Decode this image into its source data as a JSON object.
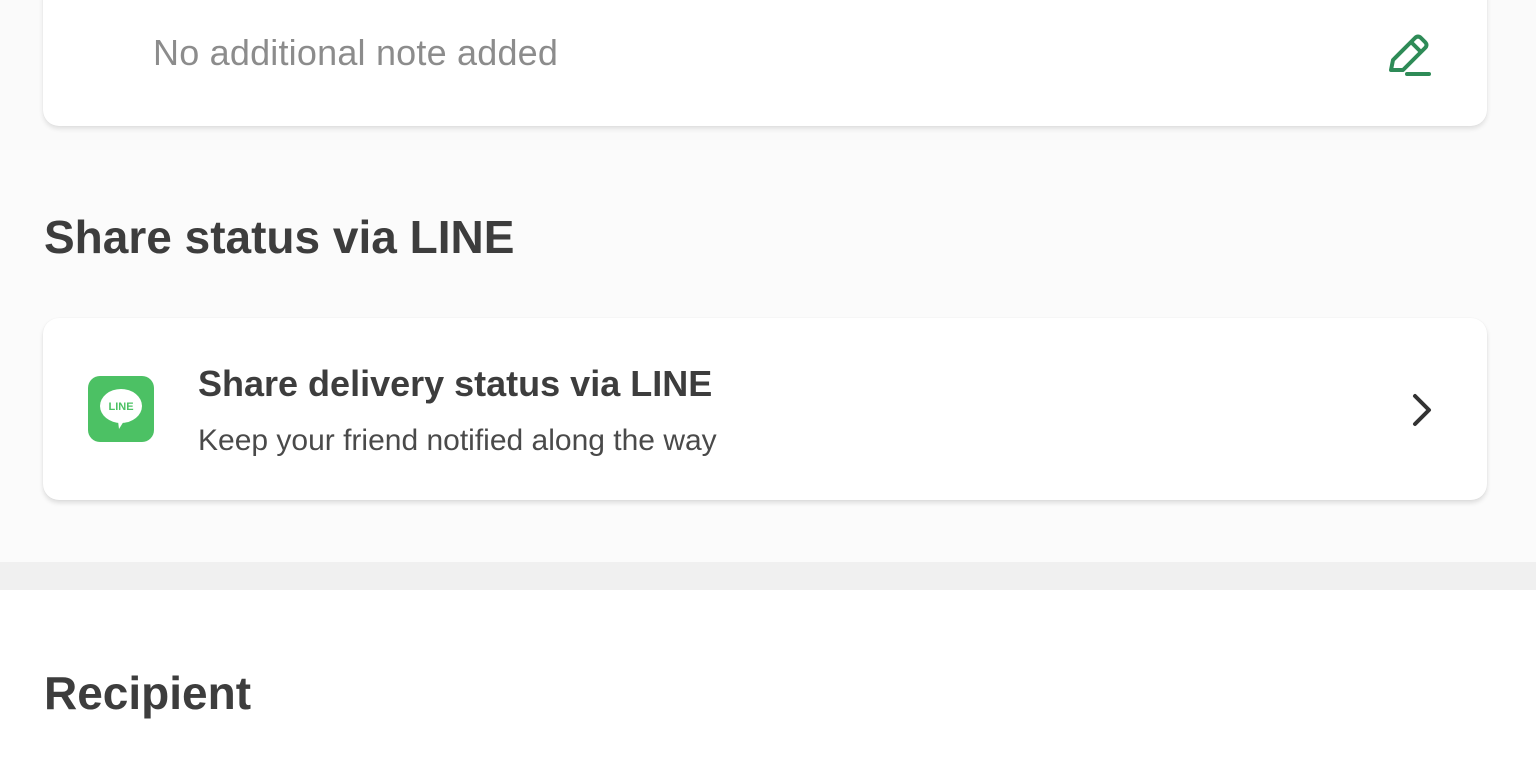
{
  "note": {
    "text": "No additional note added",
    "edit_icon": "pencil-edit-icon"
  },
  "line_section": {
    "title": "Share status via LINE",
    "card": {
      "logo_icon": "line-logo-icon",
      "logo_text": "LINE",
      "title": "Share delivery status via LINE",
      "subtitle": "Keep your friend notified along the way",
      "chevron_icon": "chevron-right-icon"
    }
  },
  "recipient_section": {
    "title": "Recipient"
  },
  "colors": {
    "accent_green": "#2e8b57",
    "line_green": "#4cc164",
    "text_primary": "#3d3d3d",
    "text_muted": "#8c8c8c"
  }
}
